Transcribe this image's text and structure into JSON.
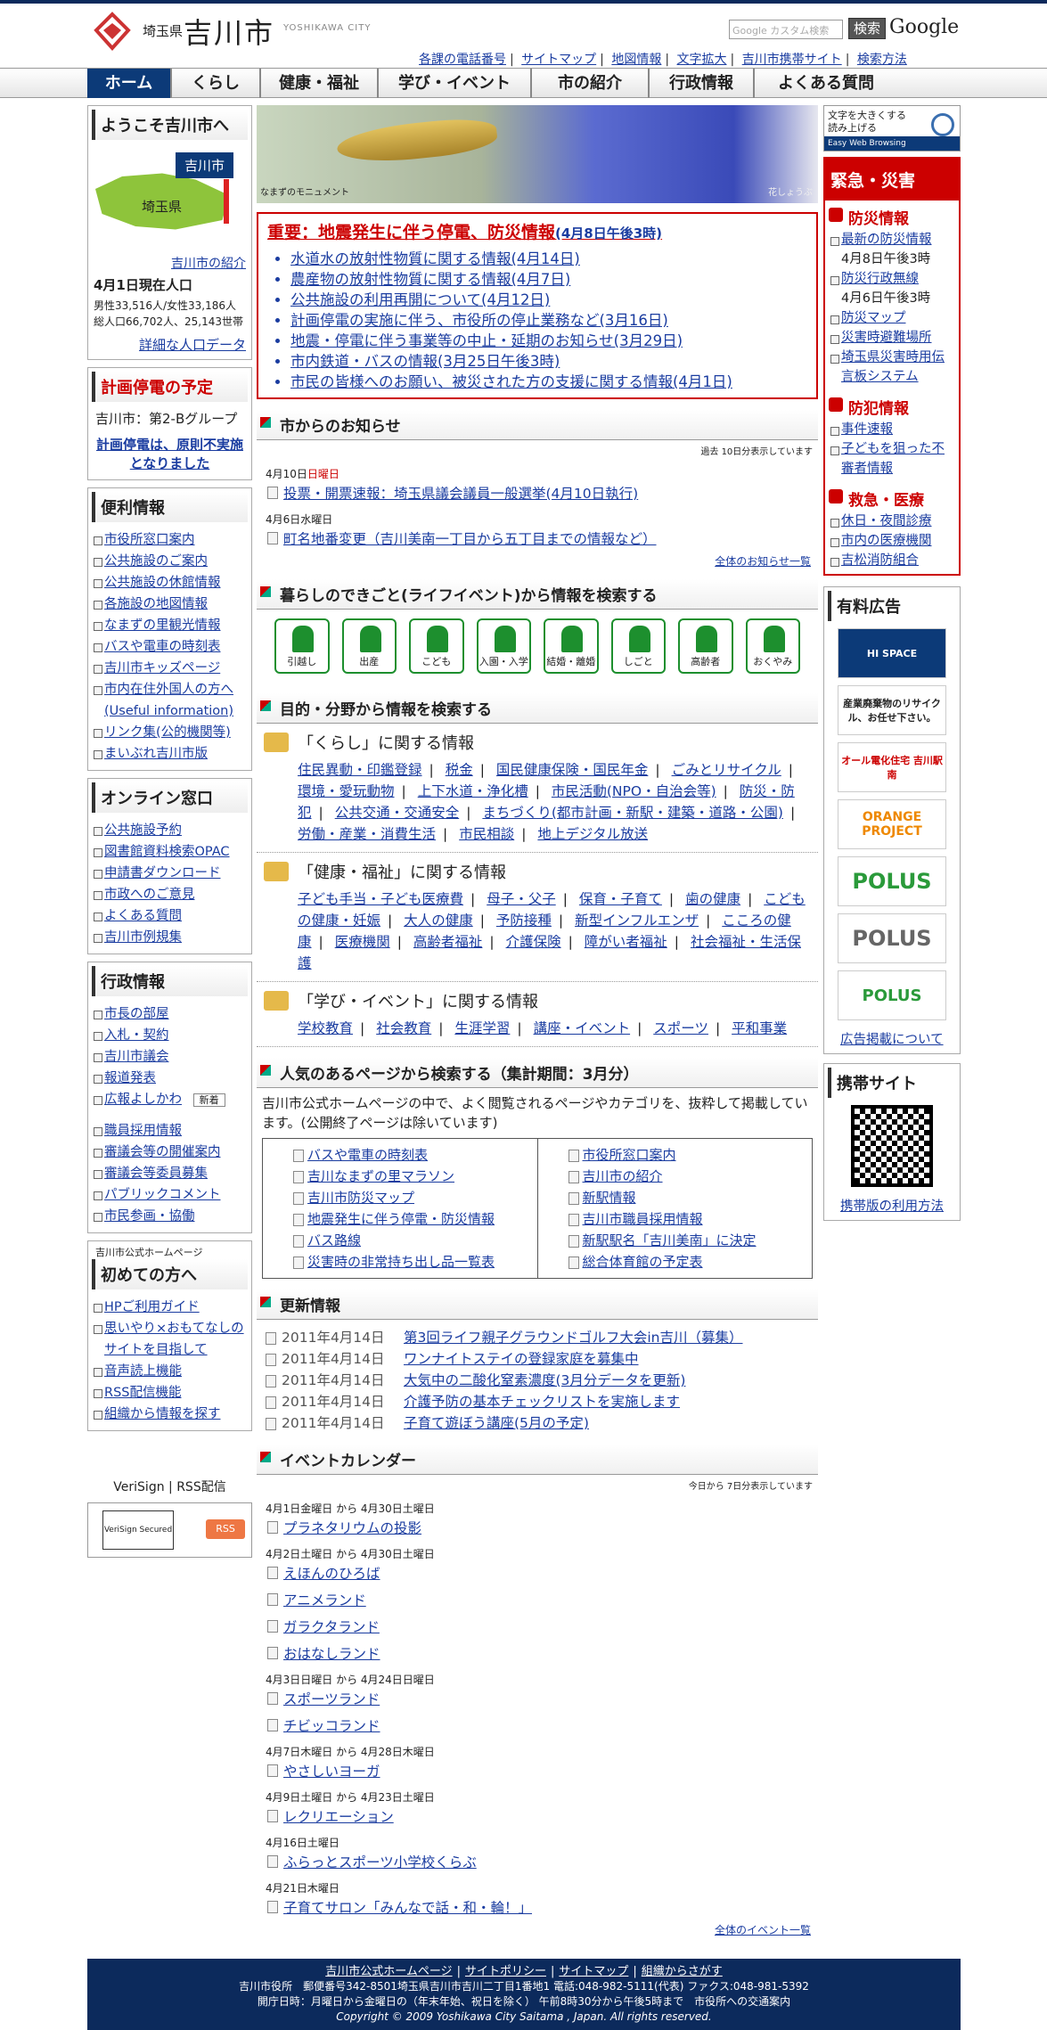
{
  "header": {
    "pref": "埼玉県",
    "city": "吉川市",
    "city_roman": "YOSHIKAWA CITY",
    "search_placeholder": "Google カスタム検索",
    "search_button": "検索",
    "google": "Google",
    "utility": [
      "各課の電話番号",
      "サイトマップ",
      "地図情報",
      "文字拡大",
      "吉川市携帯サイト",
      "検索方法"
    ]
  },
  "nav": [
    "ホーム",
    "くらし",
    "健康・福祉",
    "学び・イベント",
    "市の紹介",
    "行政情報",
    "よくある質問"
  ],
  "left": {
    "welcome_title": "ようこそ吉川市へ",
    "map_badge": "吉川市",
    "map_pref": "埼玉県",
    "intro_link": "吉川市の紹介",
    "pop_title": "4月1日現在人口",
    "pop_line1": "男性33,516人/女性33,186人",
    "pop_line2": "総人口66,702人、25,143世帯",
    "pop_detail": "詳細な人口データ",
    "outage_title": "計画停電の予定",
    "outage_group": "吉川市：第2-Bグループ",
    "outage_note": "計画停電は、原則不実施となりました",
    "convenience_title": "便利情報",
    "convenience": [
      "市役所窓口案内",
      "公共施設のご案内",
      "公共施設の休館情報",
      "各施設の地図情報",
      "なまずの里観光情報",
      "バスや電車の時刻表",
      "吉川市キッズページ",
      "市内在住外国人の方へ(Useful information)",
      "リンク集(公的機関等)",
      "まいぶれ吉川市版"
    ],
    "online_title": "オンライン窓口",
    "online": [
      "公共施設予約",
      "図書館資料検索OPAC",
      "申請書ダウンロード",
      "市政へのご意見",
      "よくある質問",
      "吉川市例規集"
    ],
    "admin_title": "行政情報",
    "admin": [
      "市長の部屋",
      "入札・契約",
      "吉川市議会",
      "報道発表",
      "広報よしかわ",
      "職員採用情報",
      "審議会等の開催案内",
      "審議会等委員募集",
      "パブリックコメント",
      "市民参画・協働"
    ],
    "admin_new": "新着",
    "first_sub": "吉川市公式ホームページ",
    "first_title": "初めての方へ",
    "first": [
      "HPご利用ガイド",
      "思いやり×おもてなしのサイトを目指して",
      "音声読上機能",
      "RSS配信機能",
      "組織から情報を探す"
    ],
    "veri_text": "VeriSign | RSS配信",
    "veri_logo": "VeriSign Secured",
    "rss": "RSS"
  },
  "main": {
    "banner_cap_left": "なまずのモニュメント",
    "banner_cap_right": "花しょうぶ",
    "important_title": "重要：地震発生に伴う停電、防災情報",
    "important_date": "(4月8日午後3時)",
    "important": [
      "水道水の放射性物質に関する情報(4月14日)",
      "農産物の放射性物質に関する情報(4月7日)",
      "公共施設の利用再開について(4月12日)",
      "計画停電の実施に伴う、市役所の停止業務など(3月16日)",
      "地震・停電に伴う事業等の中止・延期のお知らせ(3月29日)",
      "市内鉄道・バスの情報(3月25日午後3時)",
      "市民の皆様へのお願い、被災された方の支援に関する情報(4月1日)"
    ],
    "news_title": "市からのお知らせ",
    "news_note": "過去 10日分表示しています",
    "news": [
      {
        "d": "4月10日",
        "w": "日曜日",
        "t": "投票・開票速報：埼玉県議会議員一般選挙(4月10日執行)"
      },
      {
        "d": "4月6日",
        "w": "水曜日",
        "t": "町名地番変更（吉川美南一丁目から五丁目までの情報など）"
      }
    ],
    "news_more": "全体のお知らせ一覧",
    "life_title": "暮らしのできごと(ライフイベント)から情報を検索する",
    "life": [
      "引越し",
      "出産",
      "こども",
      "入園・入学",
      "結婚・離婚",
      "しごと",
      "高齢者",
      "おくやみ"
    ],
    "purpose_title": "目的・分野から情報を検索する",
    "cats": [
      {
        "title": "「くらし」に関する情報",
        "links": [
          "住民異動・印鑑登録",
          "税金",
          "国民健康保険・国民年金",
          "ごみとリサイクル",
          "環境・愛玩動物",
          "上下水道・浄化槽",
          "市民活動(NPO・自治会等)",
          "防災・防犯",
          "公共交通・交通安全",
          "まちづくり(都市計画・新駅・建築・道路・公園)",
          "労働・産業・消費生活",
          "市民相談",
          "地上デジタル放送"
        ]
      },
      {
        "title": "「健康・福祉」に関する情報",
        "links": [
          "子ども手当・子ども医療費",
          "母子・父子",
          "保育・子育て",
          "歯の健康",
          "こどもの健康・妊娠",
          "大人の健康",
          "予防接種",
          "新型インフルエンザ",
          "こころの健康",
          "医療機関",
          "高齢者福祉",
          "介護保険",
          "障がい者福祉",
          "社会福祉・生活保護"
        ]
      },
      {
        "title": "「学び・イベント」に関する情報",
        "links": [
          "学校教育",
          "社会教育",
          "生涯学習",
          "講座・イベント",
          "スポーツ",
          "平和事業"
        ]
      }
    ],
    "popular_title": "人気のあるページから検索する（集計期間：3月分）",
    "popular_intro": "吉川市公式ホームページの中で、よく閲覧されるページやカテゴリを、抜粋して掲載しています。(公開終了ページは除いています)",
    "popular_left": [
      "バスや電車の時刻表",
      "吉川なまずの里マラソン",
      "吉川市防災マップ",
      "地震発生に伴う停電・防災情報",
      "バス路線",
      "災害時の非常持ち出し品一覧表"
    ],
    "popular_right": [
      "市役所窓口案内",
      "吉川市の紹介",
      "新駅情報",
      "吉川市職員採用情報",
      "新駅駅名「吉川美南」に決定",
      "総合体育館の予定表"
    ],
    "update_title": "更新情報",
    "updates": [
      {
        "d": "2011年4月14日",
        "t": "第3回ライフ親子グラウンドゴルフ大会in吉川（募集）"
      },
      {
        "d": "2011年4月14日",
        "t": "ワンナイトステイの登録家庭を募集中"
      },
      {
        "d": "2011年4月14日",
        "t": "大気中の二酸化窒素濃度(3月分データを更新)"
      },
      {
        "d": "2011年4月14日",
        "t": "介護予防の基本チェックリストを実施します"
      },
      {
        "d": "2011年4月14日",
        "t": "子育て遊ぼう講座(5月の予定)"
      }
    ],
    "event_title": "イベントカレンダー",
    "event_note": "今日から 7日分表示しています",
    "events": [
      {
        "d": "4月1日金曜日 から 4月30日土曜日",
        "items": [
          "プラネタリウムの投影"
        ]
      },
      {
        "d": "4月2日土曜日 から 4月30日土曜日",
        "items": [
          "えほんのひろば",
          "アニメランド",
          "ガラクタランド",
          "おはなしランド"
        ]
      },
      {
        "d": "4月3日日曜日 から 4月24日日曜日",
        "items": [
          "スポーツランド",
          "チビッコランド"
        ]
      },
      {
        "d": "4月7日木曜日 から 4月28日木曜日",
        "items": [
          "やさしいヨーガ"
        ]
      },
      {
        "d": "4月9日土曜日 から 4月23日土曜日",
        "items": [
          "レクリエーション"
        ]
      },
      {
        "d": "4月16日土曜日",
        "items": [
          "ふらっとスポーツ小学校くらぶ"
        ]
      },
      {
        "d": "4月21日木曜日",
        "items": [
          "子育てサロン「みんなで話・和・輪！」"
        ]
      }
    ],
    "event_more": "全体のイベント一覧"
  },
  "right": {
    "ewb_line1": "文字を大きくする",
    "ewb_line2": "読み上げる",
    "ewb_sub": "Easy Web Browsing",
    "emerg_title": "緊急・災害",
    "bosai_title": "防災情報",
    "bosai": [
      "最新の防災情報",
      "防災行政無線",
      "防災マップ",
      "災害時避難場所",
      "埼玉県災害時用伝言板システム"
    ],
    "bosai_d1": "4月8日午後3時",
    "bosai_d2": "4月6日午後3時",
    "bohan_title": "防犯情報",
    "bohan": [
      "事件速報",
      "子どもを狙った不審者情報"
    ],
    "kyukyu_title": "救急・医療",
    "kyukyu": [
      "休日・夜間診療",
      "市内の医療機関",
      "吉松消防組合"
    ],
    "ads_title": "有料広告",
    "ads": [
      "HI SPACE",
      "産業廃棄物のリサイクル、お任せ下さい。",
      "オール電化住宅 吉川駅南",
      "ORANGE PROJECT",
      "POLUS",
      "POLUS",
      "POLUS"
    ],
    "ads_link": "広告掲載について",
    "mobile_title": "携帯サイト",
    "mobile_link": "携帯版の利用方法"
  },
  "footer": {
    "links": [
      "吉川市公式ホームページ",
      "サイトポリシー",
      "サイトマップ",
      "組織からさがす"
    ],
    "addr": "吉川市役所　郵便番号342-8501埼玉県吉川市吉川二丁目1番地1 電話:048-982-5111(代表) ファクス:048-981-5392",
    "hours": "開庁日時：月曜日から金曜日の（年末年始、祝日を除く） 午前8時30分から午後5時まで　市役所への交通案内",
    "copyright": "Copyright © 2009 Yoshikawa City Saitama , Japan. All rights reserved."
  }
}
